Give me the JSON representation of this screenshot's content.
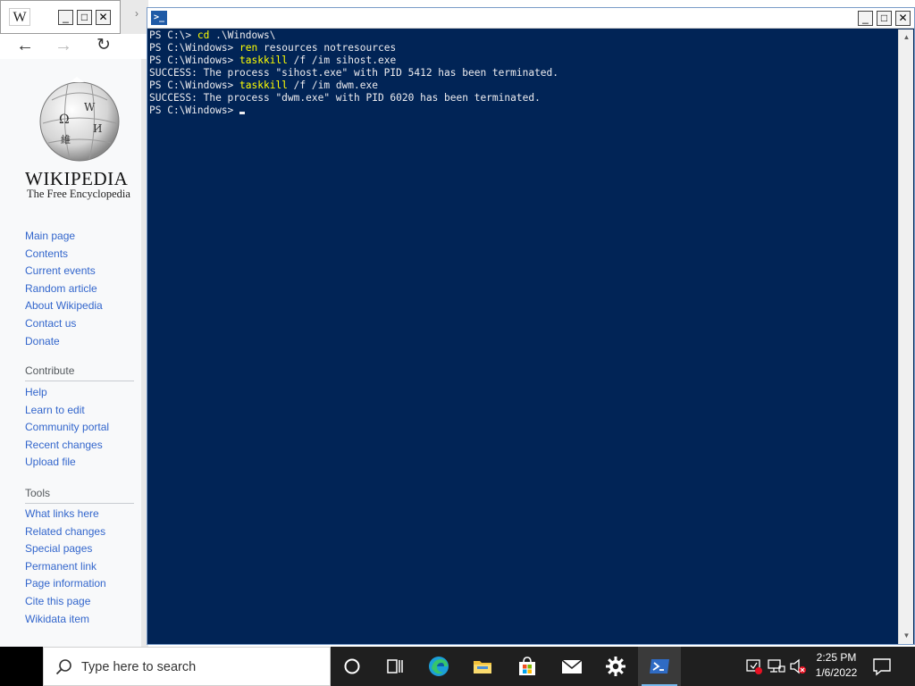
{
  "browser": {
    "tab_icon": "W",
    "min_glyph": "_",
    "max_glyph": "□",
    "close_glyph": "✕",
    "strip_glyph": "›",
    "back_glyph": "←",
    "forward_glyph": "→",
    "reload_glyph": "↻",
    "logo_title": "WIKIPEDIA",
    "logo_subtitle": "The Free Encyclopedia",
    "nav_links": [
      "Main page",
      "Contents",
      "Current events",
      "Random article",
      "About Wikipedia",
      "Contact us",
      "Donate"
    ],
    "contribute_heading": "Contribute",
    "contribute_links": [
      "Help",
      "Learn to edit",
      "Community portal",
      "Recent changes",
      "Upload file"
    ],
    "tools_heading": "Tools",
    "tools_links": [
      "What links here",
      "Related changes",
      "Special pages",
      "Permanent link",
      "Page information",
      "Cite this page",
      "Wikidata item"
    ]
  },
  "powershell": {
    "icon_glyph": ">_",
    "min_glyph": "_",
    "max_glyph": "□",
    "close_glyph": "✕",
    "background": "#012456",
    "command_color": "#ffff00",
    "lines": [
      {
        "prompt": "PS C:\\> ",
        "cmd": "cd",
        "rest": " .\\Windows\\"
      },
      {
        "prompt": "PS C:\\Windows> ",
        "cmd": "ren",
        "rest": " resources notresources"
      },
      {
        "prompt": "PS C:\\Windows> ",
        "cmd": "taskkill",
        "rest": " /f /im sihost.exe"
      },
      {
        "prompt": "SUCCESS: The process \"sihost.exe\" with PID 5412 has been terminated.",
        "cmd": "",
        "rest": ""
      },
      {
        "prompt": "PS C:\\Windows> ",
        "cmd": "taskkill",
        "rest": " /f /im dwm.exe"
      },
      {
        "prompt": "SUCCESS: The process \"dwm.exe\" with PID 6020 has been terminated.",
        "cmd": "",
        "rest": ""
      }
    ],
    "current_prompt": "PS C:\\Windows> ",
    "scroll_up": "▲",
    "scroll_down": "▼"
  },
  "taskbar": {
    "search_placeholder": "Type here to search",
    "time": "2:25 PM",
    "date": "1/6/2022",
    "apps": [
      "cortana-icon",
      "task-view-icon",
      "edge-icon",
      "file-explorer-icon",
      "store-icon",
      "mail-icon",
      "settings-icon",
      "powershell-icon"
    ],
    "accent": "#76b9ed"
  }
}
